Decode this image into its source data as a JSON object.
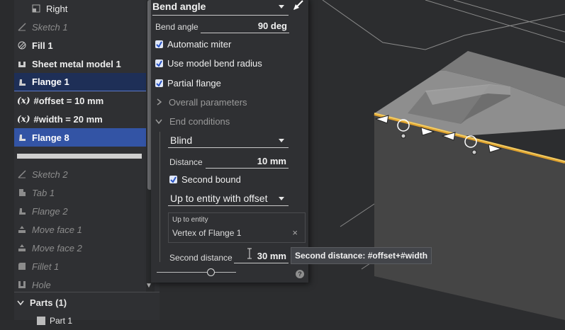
{
  "tree": {
    "items": [
      {
        "label": "Right",
        "icon": "plane-icon"
      },
      {
        "label": "Sketch 1",
        "icon": "sketch-icon"
      },
      {
        "label": "Fill 1",
        "icon": "fill-icon"
      },
      {
        "label": "Sheet metal model 1",
        "icon": "sheet-metal-icon"
      },
      {
        "label": "Flange 1",
        "icon": "flange-icon"
      },
      {
        "label": "#offset = 10 mm",
        "icon": "variable-icon"
      },
      {
        "label": "#width = 20 mm",
        "icon": "variable-icon"
      },
      {
        "label": "Flange 8",
        "icon": "flange-icon"
      },
      {
        "label": "Sketch 2",
        "icon": "sketch-icon"
      },
      {
        "label": "Tab 1",
        "icon": "tab-icon"
      },
      {
        "label": "Flange 2",
        "icon": "flange-icon"
      },
      {
        "label": "Move face 1",
        "icon": "move-face-icon"
      },
      {
        "label": "Move face 2",
        "icon": "move-face-icon"
      },
      {
        "label": "Fillet 1",
        "icon": "fillet-icon"
      },
      {
        "label": "Hole",
        "icon": "hole-icon"
      }
    ],
    "variable_glyph": "(x)",
    "parts_label": "Parts (1)",
    "part_label": "Part 1"
  },
  "dialog": {
    "top_dropdown": "Bend angle",
    "bend_angle_label": "Bend angle",
    "bend_angle_value": "90 deg",
    "automatic_miter": "Automatic miter",
    "use_model_bend_radius": "Use model bend radius",
    "partial_flange": "Partial flange",
    "overall_parameters": "Overall parameters",
    "end_conditions": "End conditions",
    "end_type": "Blind",
    "distance_label": "Distance",
    "distance_value": "10 mm",
    "second_bound": "Second bound",
    "second_end_type": "Up to entity with offset",
    "up_to_entity_label": "Up to entity",
    "up_to_entity_value": "Vertex of Flange 1",
    "second_distance_label": "Second distance",
    "second_distance_value": "30 mm",
    "help": "?"
  },
  "tooltip": "Second distance: #offset+#width",
  "colors": {
    "accent": "#3354a5",
    "edge_highlight": "#e0a22e"
  }
}
